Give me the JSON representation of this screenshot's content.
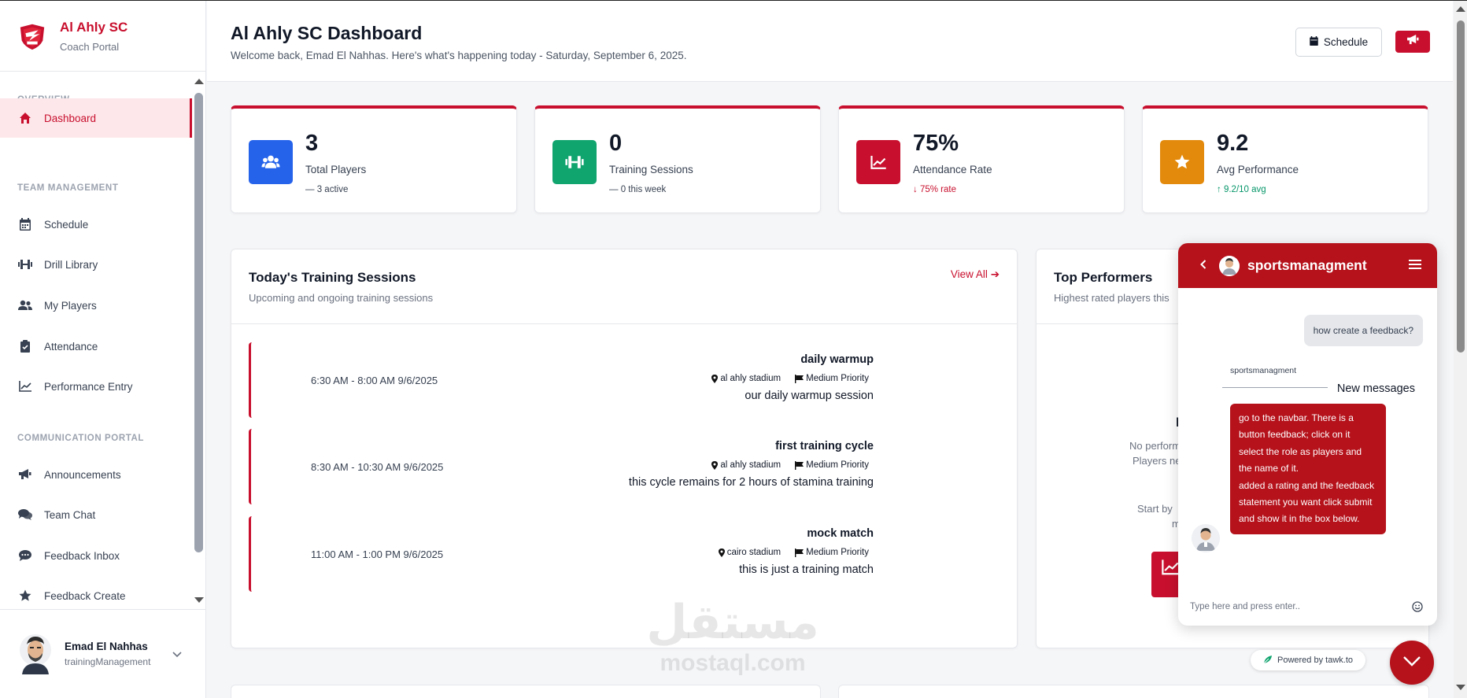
{
  "brand": {
    "title": "Al Ahly SC",
    "subtitle": "Coach Portal"
  },
  "sidebar": {
    "sections": [
      "OVERVIEW",
      "TEAM MANAGEMENT",
      "COMMUNICATION PORTAL"
    ],
    "items": [
      {
        "label": "Dashboard",
        "icon": "home-icon",
        "active": true
      },
      {
        "label": "Schedule",
        "icon": "calendar-icon"
      },
      {
        "label": "Drill Library",
        "icon": "dumbbell-icon"
      },
      {
        "label": "My Players",
        "icon": "users-icon"
      },
      {
        "label": "Attendance",
        "icon": "clipboard-icon"
      },
      {
        "label": "Performance Entry",
        "icon": "chart-line-icon"
      },
      {
        "label": "Announcements",
        "icon": "megaphone-icon"
      },
      {
        "label": "Team Chat",
        "icon": "comments-icon"
      },
      {
        "label": "Feedback Inbox",
        "icon": "comment-dots-icon"
      },
      {
        "label": "Feedback Create",
        "icon": "star-icon"
      }
    ]
  },
  "user": {
    "name": "Emad El Nahhas",
    "role": "trainingManagement"
  },
  "header": {
    "title": "Al Ahly SC Dashboard",
    "subtitle": "Welcome back, Emad El Nahhas. Here's what's happening today - Saturday, September 6, 2025.",
    "schedule_button": "Schedule"
  },
  "stats": [
    {
      "value": "3",
      "label": "Total Players",
      "trend": "3 active",
      "trend_type": "neutral",
      "color": "#2563eb",
      "icon": "users-icon"
    },
    {
      "value": "0",
      "label": "Training Sessions",
      "trend": "0 this week",
      "trend_type": "neutral",
      "color": "#10a46f",
      "icon": "dumbbell-icon"
    },
    {
      "value": "75%",
      "label": "Attendance Rate",
      "trend": "75% rate",
      "trend_type": "down",
      "color": "#c8102e",
      "icon": "chart-line-icon"
    },
    {
      "value": "9.2",
      "label": "Avg Performance",
      "trend": "9.2/10 avg",
      "trend_type": "up",
      "color": "#e38a0c",
      "icon": "star-icon"
    }
  ],
  "sessions_panel": {
    "title": "Today's Training Sessions",
    "subtitle": "Upcoming and ongoing training sessions",
    "view_all": "View All",
    "sessions": [
      {
        "time": "6:30 AM - 8:00 AM  9/6/2025",
        "name": "daily warmup",
        "location": "al ahly stadium",
        "priority": "Medium Priority",
        "description": "our daily warmup session"
      },
      {
        "time": "8:30 AM - 10:30 AM  9/6/2025",
        "name": "first training cycle",
        "location": "al ahly stadium",
        "priority": "Medium Priority",
        "description": "this cycle remains for 2 hours of stamina training"
      },
      {
        "time": "11:00 AM - 1:00 PM  9/6/2025",
        "name": "mock match",
        "location": "cairo stadium",
        "priority": "Medium Priority",
        "description": "this is just a training match"
      }
    ]
  },
  "performers_panel": {
    "title": "Top Performers",
    "subtitle": "Highest rated players this",
    "empty_title": "No",
    "empty_line1": "No perform",
    "empty_line2": "Players ne",
    "hint_line1": "Start by",
    "hint_line2": "m"
  },
  "watermark": {
    "arabic": "مستقل",
    "latin": "mostaql.com"
  },
  "chat": {
    "name": "sportsmanagment",
    "user_message": "how create a feedback?",
    "agent_label": "sportsmanagment",
    "new_messages": "New messages",
    "agent_message": "go to the navbar. There is a button feedback; click on it select the role as players and the name of it.\nadded a rating and the feedback statement you want click submit and show it in the box below.",
    "input_placeholder": "Type here and press enter..",
    "powered_by": "Powered by tawk.to",
    "color": "#b5121b"
  }
}
